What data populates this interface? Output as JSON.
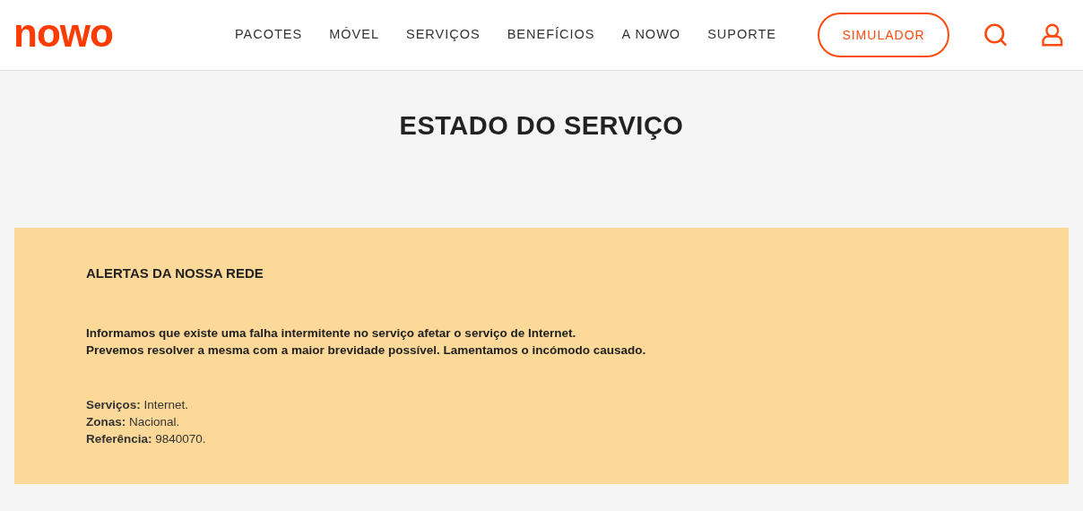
{
  "header": {
    "logo": "nowo",
    "nav": [
      {
        "label": "PACOTES"
      },
      {
        "label": "MÓVEL"
      },
      {
        "label": "SERVIÇOS"
      },
      {
        "label": "BENEFÍCIOS"
      },
      {
        "label": "A NOWO"
      },
      {
        "label": "SUPORTE"
      }
    ],
    "cta": "SIMULADOR"
  },
  "page_title": "ESTADO DO SERVIÇO",
  "alert": {
    "title": "ALERTAS DA NOSSA REDE",
    "message": [
      "Informamos que existe uma falha intermitente no serviço afetar o serviço de Internet.",
      "Prevemos resolver a mesma com a maior brevidade possível. Lamentamos o incómodo causado."
    ],
    "details": [
      "**Serviços:** Internet.",
      "**Zonas:** Nacional.",
      "**Referência:** 9840070."
    ]
  }
}
